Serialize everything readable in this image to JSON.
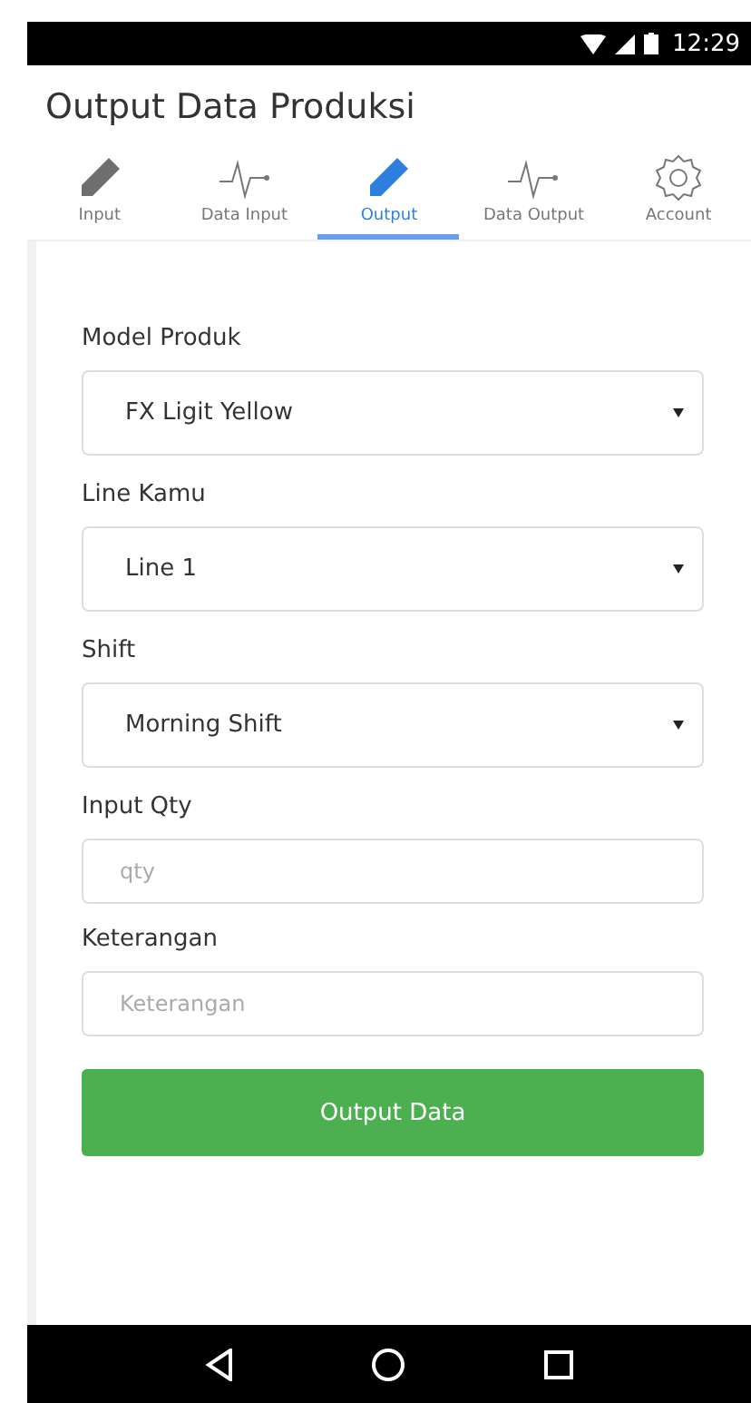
{
  "status_bar": {
    "time": "12:29"
  },
  "app_bar": {
    "title": "Output Data Produksi"
  },
  "tabs": [
    {
      "label": "Input",
      "kind": "edit",
      "selected": false
    },
    {
      "label": "Data Input",
      "kind": "activity",
      "selected": false
    },
    {
      "label": "Output",
      "kind": "edit",
      "selected": true
    },
    {
      "label": "Data Output",
      "kind": "activity",
      "selected": false
    },
    {
      "label": "Account",
      "kind": "settings",
      "selected": false
    }
  ],
  "form": {
    "fields": [
      {
        "label": "Model Produk",
        "kind": "select",
        "value": "FX Ligit Yellow"
      },
      {
        "label": "Line Kamu",
        "kind": "select",
        "value": "Line 1"
      },
      {
        "label": "Shift",
        "kind": "select",
        "value": "Morning Shift"
      },
      {
        "label": "Input Qty",
        "kind": "text",
        "placeholder": "qty"
      },
      {
        "label": "Keterangan",
        "kind": "text",
        "placeholder": "Keterangan"
      }
    ],
    "submit": "Output Data"
  }
}
